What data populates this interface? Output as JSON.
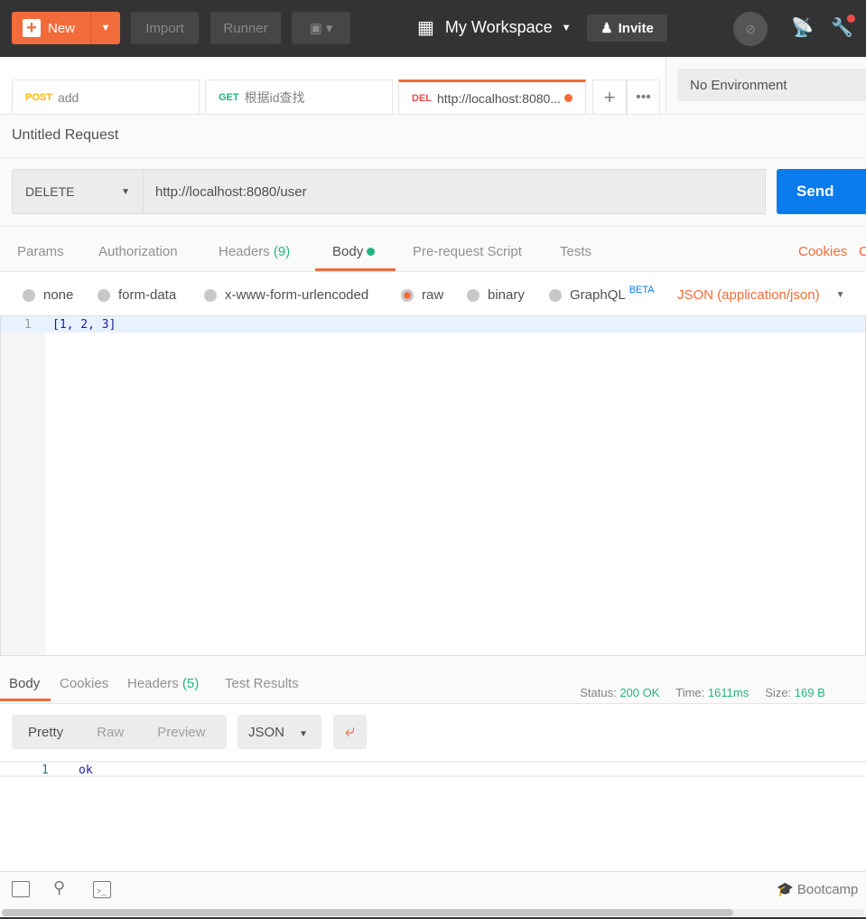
{
  "header": {
    "new": "New",
    "import": "Import",
    "runner": "Runner",
    "workspace": "My Workspace",
    "invite": "Invite"
  },
  "tabs": [
    {
      "method": "POST",
      "name": "add",
      "color": "#ffb400"
    },
    {
      "method": "GET",
      "name": "根据id查找",
      "color": "#26b47f"
    },
    {
      "method": "DEL",
      "name": "http://localhost:8080...",
      "color": "#ed4b48"
    }
  ],
  "environment": "No Environment",
  "request": {
    "title": "Untitled Request",
    "method": "DELETE",
    "url": "http://localhost:8080/user",
    "send": "Send"
  },
  "req_tabs": {
    "params": "Params",
    "authorization": "Authorization",
    "headers": "Headers",
    "headers_count": "(9)",
    "body": "Body",
    "prerequest": "Pre-request Script",
    "tests": "Tests",
    "cookies": "Cookies",
    "code": "C"
  },
  "body_types": {
    "none": "none",
    "form_data": "form-data",
    "urlencoded": "x-www-form-urlencoded",
    "raw": "raw",
    "binary": "binary",
    "graphql": "GraphQL",
    "beta": "BETA",
    "content_type": "JSON (application/json)"
  },
  "editor": {
    "line": "1",
    "code": "[1, 2, 3]"
  },
  "response": {
    "body": "Body",
    "cookies": "Cookies",
    "headers": "Headers",
    "headers_count": "(5)",
    "tests": "Test Results",
    "status_label": "Status:",
    "status": "200 OK",
    "time_label": "Time:",
    "time": "1611ms",
    "size_label": "Size:",
    "size": "169 B",
    "pretty": "Pretty",
    "raw": "Raw",
    "preview": "Preview",
    "format": "JSON",
    "line": "1",
    "code": "ok"
  },
  "footer": {
    "bootcamp": "Bootcamp"
  },
  "colors": {
    "accent": "#f26b3a",
    "send": "#097bed",
    "green": "#26b47f"
  }
}
